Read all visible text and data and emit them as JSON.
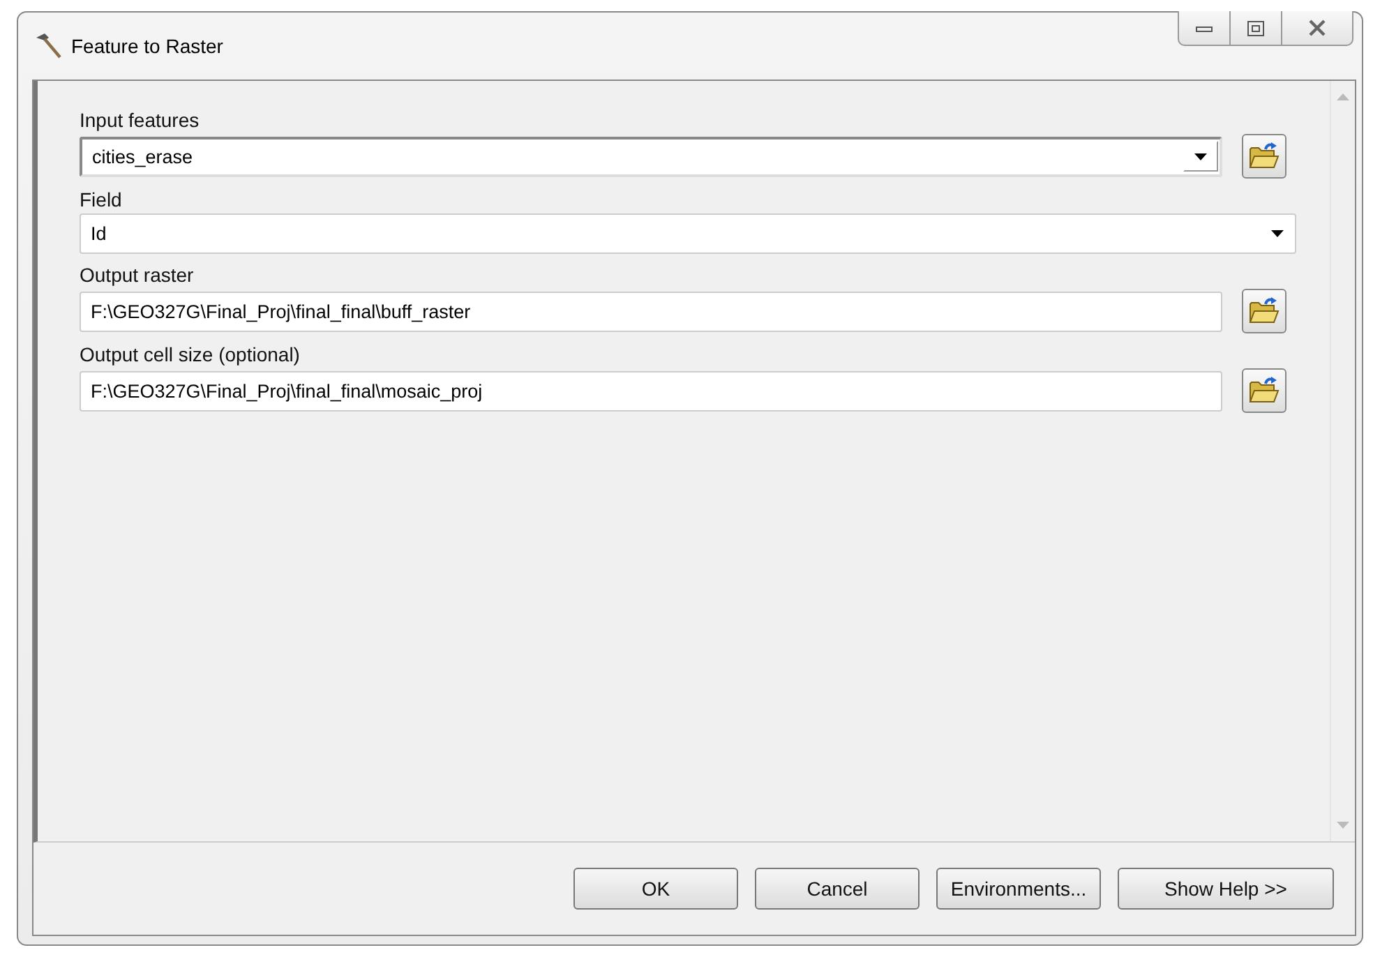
{
  "window": {
    "title": "Feature to Raster"
  },
  "parameters": [
    {
      "label": "Input features",
      "kind": "combo",
      "value": "cities_erase",
      "browse": true
    },
    {
      "label": "Field",
      "kind": "dropdown",
      "value": "Id",
      "browse": false
    },
    {
      "label": "Output raster",
      "kind": "text",
      "value": "F:\\GEO327G\\Final_Proj\\final_final\\buff_raster",
      "browse": true
    },
    {
      "label": "Output cell size (optional)",
      "kind": "text",
      "value": "F:\\GEO327G\\Final_Proj\\final_final\\mosaic_proj",
      "browse": true
    }
  ],
  "buttons": [
    "OK",
    "Cancel",
    "Environments...",
    "Show Help >>"
  ]
}
